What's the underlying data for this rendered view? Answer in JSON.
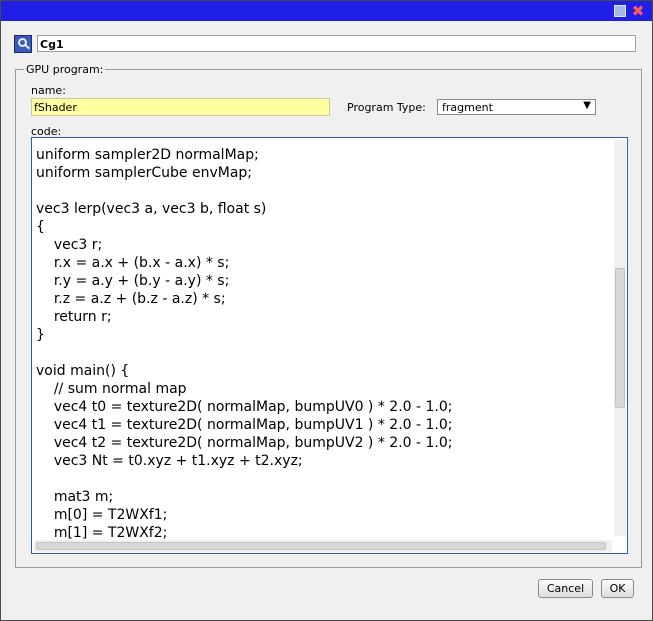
{
  "title_bar": {
    "maximize_icon": "maximize-icon",
    "close_icon": "close-icon",
    "close_glyph": "✖"
  },
  "object": {
    "icon": "cg-program-icon",
    "name": "Cg1"
  },
  "gpu_program": {
    "legend": "GPU program:",
    "name_label": "name:",
    "name_value": "fShader",
    "program_type_label": "Program Type:",
    "program_type_value": "fragment",
    "code_label": "code:",
    "code": "uniform sampler2D normalMap;\nuniform samplerCube envMap;\n\nvec3 lerp(vec3 a, vec3 b, float s)\n{\n\tvec3 r;\n\tr.x = a.x + (b.x - a.x) * s;\n\tr.y = a.y + (b.y - a.y) * s;\n\tr.z = a.z + (b.z - a.z) * s;\n\treturn r;\n}\n\nvoid main() {\n\t// sum normal map\n\tvec4 t0 = texture2D( normalMap, bumpUV0 ) * 2.0 - 1.0;\n\tvec4 t1 = texture2D( normalMap, bumpUV1 ) * 2.0 - 1.0;\n\tvec4 t2 = texture2D( normalMap, bumpUV2 ) * 2.0 - 1.0;\n\tvec3 Nt = t0.xyz + t1.xyz + t2.xyz;\n\n\tmat3 m;\n\tm[0] = T2WXf1;\n\tm[1] = T2WXf2;"
  },
  "buttons": {
    "cancel": "Cancel",
    "ok": "OK"
  },
  "colors": {
    "title_bar": "#1f1fe6",
    "name_field_highlight": "#ffffa0",
    "code_border": "#2b5fb3"
  }
}
